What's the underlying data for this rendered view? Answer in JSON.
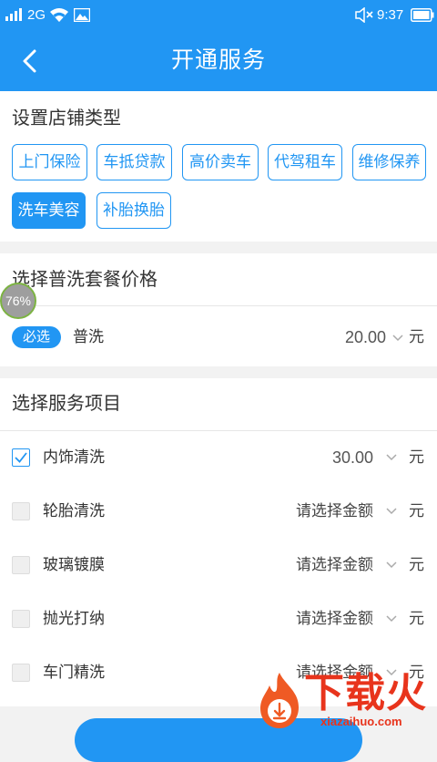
{
  "status_bar": {
    "network": "2G",
    "time": "9:37",
    "icons": [
      "signal-icon",
      "wifi-icon",
      "image-icon",
      "mute-icon",
      "battery-icon"
    ]
  },
  "header": {
    "back_icon": "chevron-left-icon",
    "title": "开通服务"
  },
  "shop_type": {
    "heading": "设置店铺类型",
    "tags": [
      {
        "label": "上门保险",
        "selected": false
      },
      {
        "label": "车抵贷款",
        "selected": false
      },
      {
        "label": "高价卖车",
        "selected": false
      },
      {
        "label": "代驾租车",
        "selected": false
      },
      {
        "label": "维修保养",
        "selected": false
      },
      {
        "label": "洗车美容",
        "selected": true
      },
      {
        "label": "补胎换胎",
        "selected": false
      }
    ]
  },
  "overlay": {
    "percent": "76%"
  },
  "package": {
    "heading": "选择普洗套餐价格",
    "badge": "必选",
    "name": "普洗",
    "price": "20.00",
    "unit": "元"
  },
  "services": {
    "heading": "选择服务项目",
    "items": [
      {
        "name": "内饰清洗",
        "checked": true,
        "value": "30.00",
        "unit": "元"
      },
      {
        "name": "轮胎清洗",
        "checked": false,
        "value": "请选择金额",
        "unit": "元"
      },
      {
        "name": "玻璃镀膜",
        "checked": false,
        "value": "请选择金额",
        "unit": "元"
      },
      {
        "name": "抛光打纳",
        "checked": false,
        "value": "请选择金额",
        "unit": "元"
      },
      {
        "name": "车门精洗",
        "checked": false,
        "value": "请选择金额",
        "unit": "元"
      }
    ]
  },
  "watermark": {
    "brand": "下载火",
    "site": "xiazaihuo.com"
  },
  "colors": {
    "primary": "#2196f3",
    "background": "#f2f2f2",
    "watermark": "#e8341c"
  }
}
